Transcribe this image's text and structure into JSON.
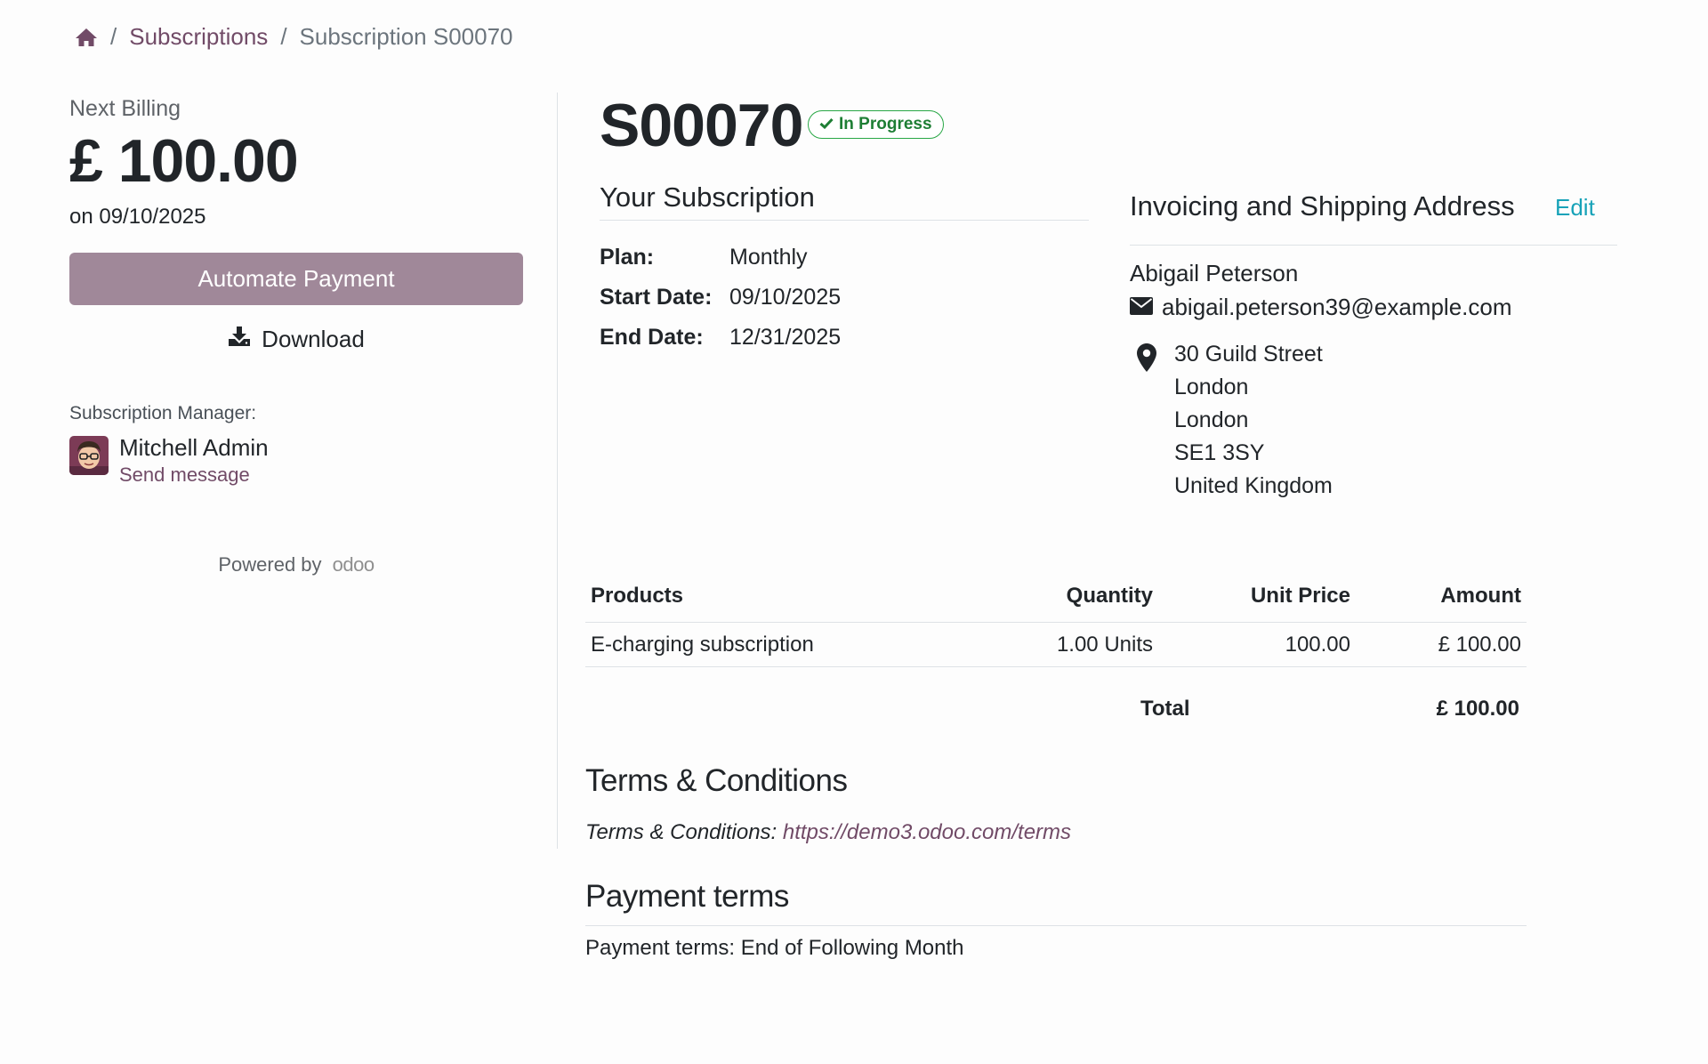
{
  "breadcrumb": {
    "home_icon": "home-icon",
    "separator": "/",
    "subscriptions": "Subscriptions",
    "current": "Subscription S00070"
  },
  "sidebar": {
    "next_billing_label": "Next Billing",
    "next_billing_amount": "£ 100.00",
    "next_billing_date": "on 09/10/2025",
    "automate_button": "Automate Payment",
    "download_label": "Download",
    "manager_label": "Subscription Manager:",
    "manager_name": "Mitchell Admin",
    "send_message": "Send message",
    "powered_by": "Powered by",
    "brand": "odoo"
  },
  "header": {
    "subscription_id": "S00070",
    "status": "In Progress",
    "status_color": "#28a745"
  },
  "your_subscription": {
    "heading": "Your Subscription",
    "rows": [
      {
        "label": "Plan:",
        "value": "Monthly"
      },
      {
        "label": "Start Date:",
        "value": "09/10/2025"
      },
      {
        "label": "End Date:",
        "value": "12/31/2025"
      }
    ]
  },
  "address": {
    "heading": "Invoicing and Shipping Address",
    "edit": "Edit",
    "name": "Abigail Peterson",
    "email": "abigail.peterson39@example.com",
    "lines": [
      "30 Guild Street",
      "London",
      "London",
      "SE1 3SY",
      "United Kingdom"
    ]
  },
  "products": {
    "columns": [
      "Products",
      "Quantity",
      "Unit Price",
      "Amount"
    ],
    "rows": [
      {
        "product": "E-charging subscription",
        "quantity": "1.00 Units",
        "unit_price": "100.00",
        "amount": "£ 100.00"
      }
    ],
    "total_label": "Total",
    "total_value": "£ 100.00"
  },
  "terms": {
    "heading": "Terms & Conditions",
    "label": "Terms & Conditions:",
    "link": "https://demo3.odoo.com/terms"
  },
  "payment_terms": {
    "heading": "Payment terms",
    "text": "Payment terms: End of Following Month"
  },
  "colors": {
    "brand": "#714b67",
    "button": "#a08899",
    "edit_link": "#17a2b8"
  }
}
